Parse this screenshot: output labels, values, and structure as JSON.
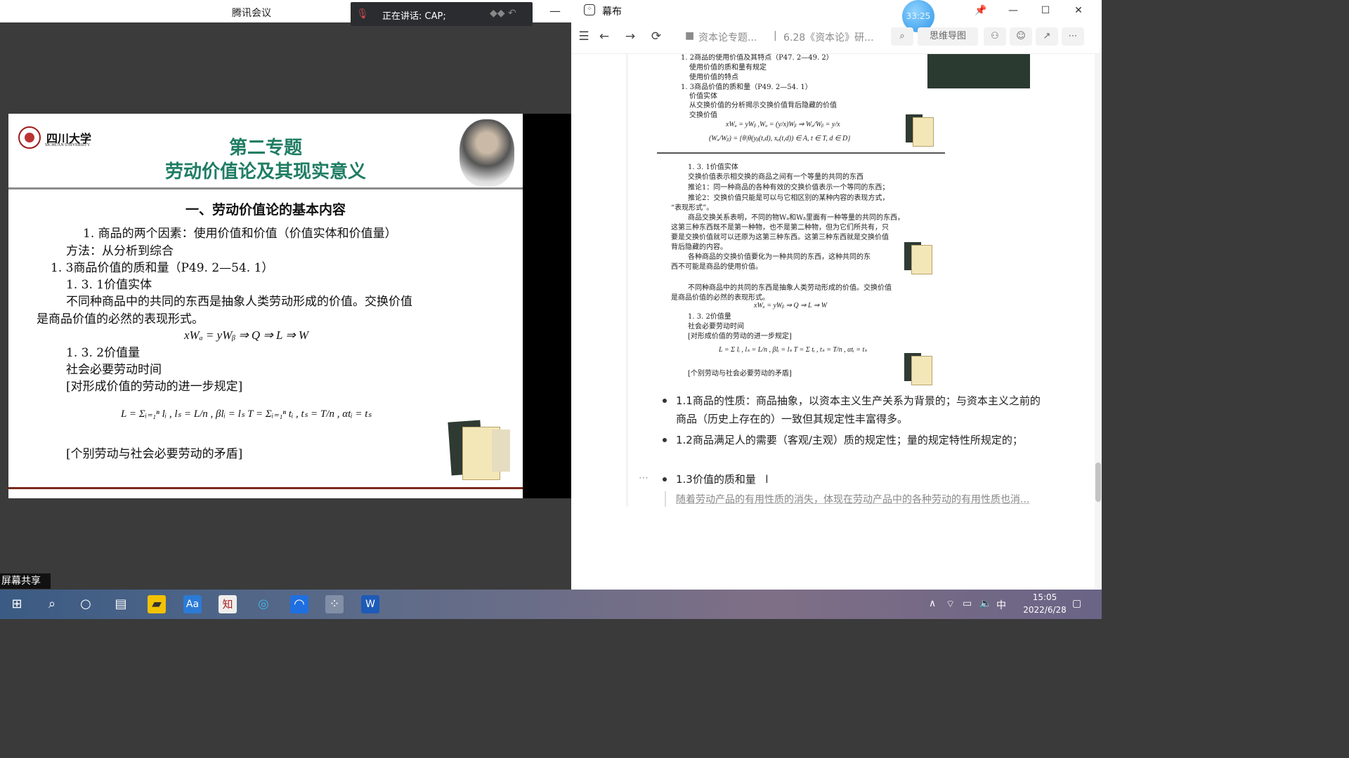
{
  "tencent_meeting": {
    "title": "腾讯会议",
    "speaking_label": "正在讲话: CAP;",
    "screen_share_tag": "屏幕共享",
    "slide": {
      "university_cn": "四川大学",
      "university_en": "SICHUAN UNIVERSITY",
      "title_line1": "第二专题",
      "title_line2": "劳动价值论及其现实意义",
      "heading": "一、劳动价值论的基本内容",
      "lines": [
        "1. 商品的两个因素：使用价值和价值（价值实体和价值量）",
        "方法：从分析到综合",
        "1. 3商品价值的质和量（P49. 2—54. 1）",
        "1. 3. 1价值实体",
        "不同种商品中的共同的东西是抽象人类劳动形成的价值。交换价值",
        "是商品价值的必然的表现形式。",
        "1. 3. 2价值量",
        "社会必要劳动时间",
        "[对形成价值的劳动的进一步规定]",
        "[个别劳动与社会必要劳动的矛盾]"
      ],
      "formula1": "xWₐ = yWᵦ ⇒ Q ⇒ L ⇒ W",
      "formula2": "L = Σᵢ₌₁ⁿ lᵢ , lₛ = L/n , βlᵢ = lₛ     T = Σᵢ₌₁ⁿ tᵢ , tₛ = T/n , αtᵢ = tₛ"
    }
  },
  "mubu": {
    "app_title": "幕布",
    "timer": "33:25",
    "breadcrumb": [
      "资本论专题...",
      "6.28《资本论》研..."
    ],
    "mindmap_label": "思维导图",
    "embed_top": {
      "lines": [
        "1. 2商品的使用价值及其特点（P47. 2—49. 2）",
        "使用价值的质和量有规定",
        "使用价值的特点",
        "1. 3商品价值的质和量（P49. 2—54. 1）",
        "价值实体",
        "从交换价值的分析揭示交换价值背后隐藏的价值",
        "交换价值"
      ],
      "formula_a": "xWₐ = yWᵦ ,Wₐ = (y/x)Wᵦ ⇒ Wₐ/Wᵦ = y/x",
      "formula_b": "(Wₐ/Wᵦ) = {θ|θ(yᵦ(t,d), xₐ(t,d)) ∈ A, t ∈ T, d ∈ D}"
    },
    "embed_mid": {
      "lines": [
        "1. 3. 1价值实体",
        "交换价值表示相交换的商品之间有一个等量的共同的东西",
        "推论1：同一种商品的各种有效的交换价值表示一个等同的东西；",
        "推论2：交换价值只能是可以与它相区别的某种内容的表现方式，",
        "“表现形式”。",
        "商品交换关系表明，不同的物Wₐ和Wᵦ里面有一种等量的共同的东西，",
        "这第三种东西既不是第一种物，也不是第二种物，但为它们所共有，只",
        "要是交换价值就可以还原为这第三种东西。这第三种东西就是交换价值",
        "背后隐藏的内容。",
        "各种商品的交换价值要化为一种共同的东西，这种共同的东",
        "西不可能是商品的使用价值。",
        "不同种商品中的共同的东西是抽象人类劳动形成的价值。交换价值",
        "是商品价值的必然的表现形式。",
        "1. 3. 2价值量",
        "社会必要劳动时间",
        "[对形成价值的劳动的进一步规定]",
        "[个别劳动与社会必要劳动的矛盾]"
      ],
      "formula_a": "xWₐ = yWᵦ ⇒ Q ⇒ L ⇒ W",
      "formula_b": "L = Σ lᵢ , lₛ = L/n , βlᵢ = lₛ    T = Σ tᵢ , tₛ = T/n , αtᵢ = tₛ"
    },
    "bullets": [
      "1.1商品的性质：商品抽象，以资本主义生产关系为背景的；与资本主义之前的商品（历史上存在的）一致但其规定性丰富得多。",
      "1.2商品满足人的需要（客观/主观）质的规定性；量的规定特性所规定的；",
      "1.3价值的质和量"
    ],
    "note": "随着劳动产品的有用性质的消失，体现在劳动产品中的各种劳动的有用性质也消..."
  },
  "taskbar": {
    "time": "15:05",
    "date": "2022/6/28",
    "ime": "中"
  },
  "colors": {
    "slide_title_green": "#1f7d63",
    "timer_blue": "#2e95e6",
    "taskbar": "#5e6c89"
  }
}
